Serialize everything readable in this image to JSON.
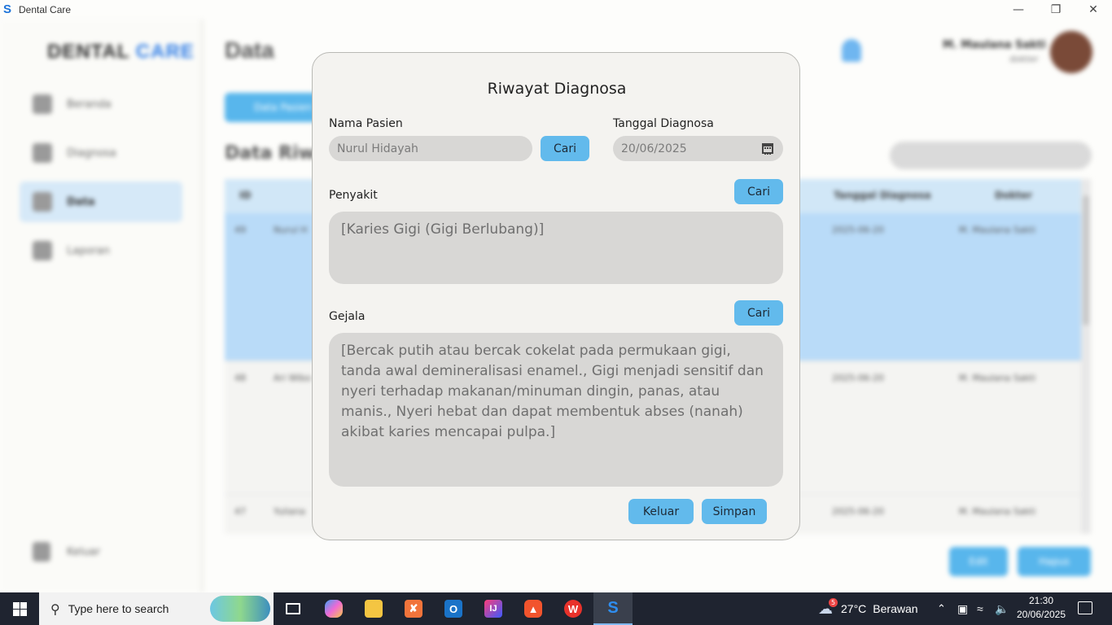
{
  "window": {
    "title": "Dental Care",
    "minimize": "—",
    "restore": "❐",
    "close": "✕"
  },
  "background": {
    "logo_dark": "DENTAL",
    "logo_blue": "CARE",
    "page_title": "Data",
    "nav": [
      {
        "label": "Beranda"
      },
      {
        "label": "Diagnosa"
      },
      {
        "label": "Data"
      },
      {
        "label": "Laporan"
      }
    ],
    "logout_label": "Keluar",
    "user_name": "M. Maulana Sakti",
    "user_role": "dokter",
    "data_button": "Data Pasien",
    "section_title": "Data Riwayat",
    "table": {
      "headers": [
        "ID",
        "Tanggal Diagnosa",
        "Dokter"
      ],
      "rows": [
        {
          "id": "49",
          "name": "Nurul H",
          "date": "2025-06-20",
          "doctor": "M. Maulana Sakti"
        },
        {
          "id": "48",
          "name": "Ari Wibo",
          "date": "2025-06-20",
          "doctor": "M. Maulana Sakti"
        },
        {
          "id": "47",
          "name": "Yuliana",
          "date": "2025-06-20",
          "doctor": "M. Maulana Sakti"
        }
      ]
    },
    "edit_label": "Edit",
    "hapus_label": "Hapus"
  },
  "modal": {
    "title": "Riwayat Diagnosa",
    "nama_pasien_label": "Nama Pasien",
    "nama_pasien_value": "Nurul Hidayah",
    "cari_label": "Cari",
    "tanggal_label": "Tanggal Diagnosa",
    "tanggal_value": "20/06/2025",
    "penyakit_label": "Penyakit",
    "penyakit_value": "[Karies Gigi (Gigi Berlubang)]",
    "gejala_label": "Gejala",
    "gejala_value": "[Bercak putih atau bercak cokelat pada permukaan gigi, tanda awal demineralisasi enamel., Gigi menjadi sensitif dan nyeri terhadap makanan/minuman dingin, panas, atau manis., Nyeri hebat dan dapat membentuk abses (nanah) akibat karies mencapai pulpa.]",
    "keluar_label": "Keluar",
    "simpan_label": "Simpan"
  },
  "taskbar": {
    "search_placeholder": "Type here to search",
    "weather_temp": "27°C",
    "weather_desc": "Berawan",
    "weather_badge": "5",
    "time": "21:30",
    "date": "20/06/2025"
  },
  "colors": {
    "accent": "#62baec",
    "selected_row": "#b9dbf8",
    "logo_blue": "#2f7de6",
    "taskbar": "#1f2430"
  }
}
